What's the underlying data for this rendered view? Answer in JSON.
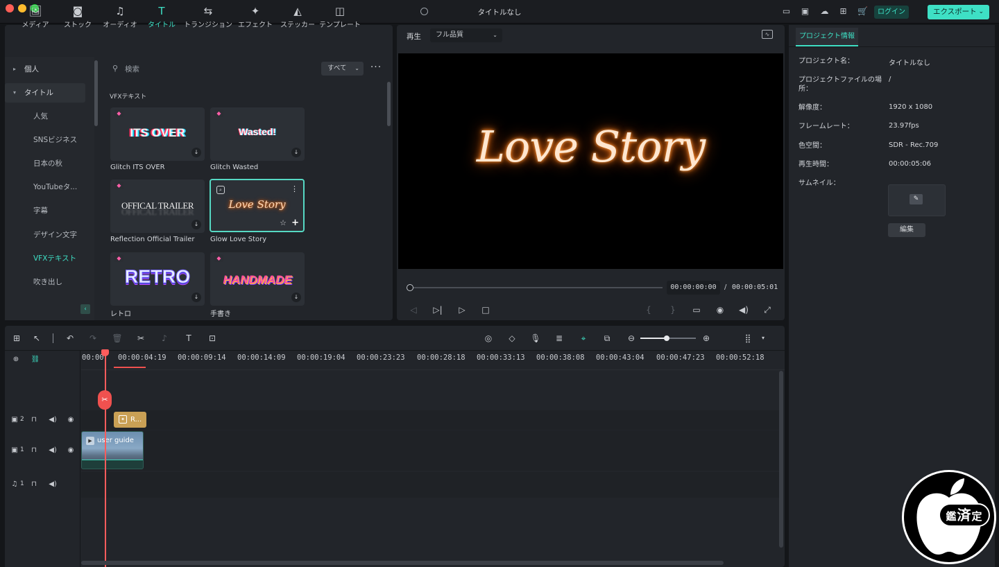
{
  "window": {
    "title": "タイトルなし",
    "traffic_lights": [
      "#ff5f57",
      "#febc2e",
      "#28c840"
    ]
  },
  "topbar": {
    "login_label": "ログイン",
    "export_label": "エクスポート"
  },
  "toolbar_tabs": [
    {
      "label": "メディア",
      "icon": "media-icon"
    },
    {
      "label": "ストック",
      "icon": "stock-icon"
    },
    {
      "label": "オーディオ",
      "icon": "music-note-icon"
    },
    {
      "label": "タイトル",
      "icon": "text-t-icon",
      "active": true
    },
    {
      "label": "トランジション",
      "icon": "transition-icon"
    },
    {
      "label": "エフェクト",
      "icon": "sparkle-icon"
    },
    {
      "label": "ステッカー",
      "icon": "sticker-icon"
    },
    {
      "label": "テンプレート",
      "icon": "template-icon"
    }
  ],
  "categories": {
    "personal": "個人",
    "title": "タイトル",
    "items": [
      "人気",
      "SNSビジネス",
      "日本の秋",
      "YouTubeタ...",
      "字幕",
      "デザイン文字",
      "VFXテキスト",
      "吹き出し"
    ],
    "active_item": "VFXテキスト"
  },
  "library": {
    "search_placeholder": "検索",
    "filter_value": "すべて",
    "section_label": "VFXテキスト",
    "cards": [
      {
        "name": "Glitch ITS OVER",
        "thumb_text": "ITS OVER"
      },
      {
        "name": "Glitch Wasted",
        "thumb_text": "Wasted!"
      },
      {
        "name": "Reflection Official Trailer",
        "thumb_text": "OFFICAL TRAILER"
      },
      {
        "name": "Glow Love Story",
        "thumb_text": "Love Story",
        "selected": true
      },
      {
        "name": "レトロ",
        "thumb_text": "RETRO"
      },
      {
        "name": "手書き",
        "thumb_text": "HANDMADE"
      }
    ]
  },
  "preview": {
    "play_label": "再生",
    "quality": "フル品質",
    "canvas_text": "Love Story",
    "current_time": "00:00:00:00",
    "separator": "/",
    "total_time": "00:00:05:01",
    "progress": 0
  },
  "project_info": {
    "tab_label": "プロジェクト情報",
    "rows": [
      {
        "key": "プロジェクト名：",
        "value": "タイトルなし"
      },
      {
        "key": "プロジェクトファイルの場所：",
        "value": "/"
      },
      {
        "key": "解像度：",
        "value": "1920 x 1080"
      },
      {
        "key": "フレームレート：",
        "value": "23.97fps"
      },
      {
        "key": "色空間：",
        "value": "SDR - Rec.709"
      },
      {
        "key": "再生時間：",
        "value": "00:00:05:06"
      },
      {
        "key": "サムネイル：",
        "value": ""
      }
    ],
    "edit_label": "編集"
  },
  "timeline": {
    "ruler_ticks": [
      "00:00",
      "00:00:04:19",
      "00:00:09:14",
      "00:00:14:09",
      "00:00:19:04",
      "00:00:23:23",
      "00:00:28:18",
      "00:00:33:13",
      "00:00:38:08",
      "00:00:43:04",
      "00:00:47:23",
      "00:00:52:18"
    ],
    "tracks": [
      {
        "number": "2",
        "type": "video"
      },
      {
        "number": "1",
        "type": "video"
      },
      {
        "number": "1",
        "type": "audio"
      }
    ],
    "title_clip_label": "R...",
    "video_clip_label": "user guide",
    "zoom_level": 0.48
  },
  "watermark": {
    "text_left": "鑑",
    "text_center": "済",
    "text_right": "定"
  },
  "colors": {
    "accent": "#3ee0c5",
    "playhead": "#ff5c5c",
    "title_clip": "#c9a055",
    "glow": "#ff7a1a"
  }
}
